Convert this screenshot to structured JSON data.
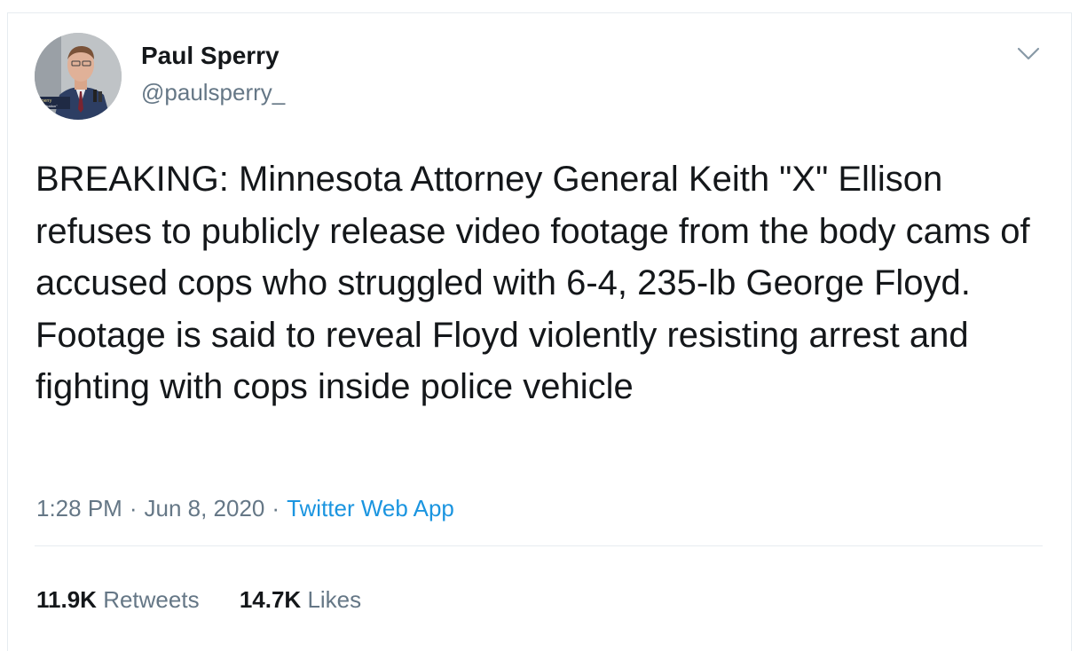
{
  "author": {
    "display_name": "Paul Sperry",
    "handle": "@paulsperry_",
    "avatar_caption": [
      "l Sperry",
      "r, \"Infiltration\""
    ]
  },
  "tweet": {
    "text": "BREAKING: Minnesota Attorney General Keith \"X\" Ellison refuses to publicly release video footage from the body cams of accused cops who struggled with 6-4, 235-lb George Floyd. Footage is said to reveal Floyd violently resisting arrest and fighting with cops inside police vehicle",
    "time": "1:28 PM",
    "date": "Jun 8, 2020",
    "separator": "·",
    "source": "Twitter Web App"
  },
  "stats": {
    "retweets_count": "11.9K",
    "retweets_label": "Retweets",
    "likes_count": "14.7K",
    "likes_label": "Likes"
  },
  "icons": {
    "menu": "chevron-down-icon"
  },
  "colors": {
    "link": "#1b95e0",
    "muted": "#657786",
    "text": "#14171a",
    "border": "#e6ecf0"
  }
}
